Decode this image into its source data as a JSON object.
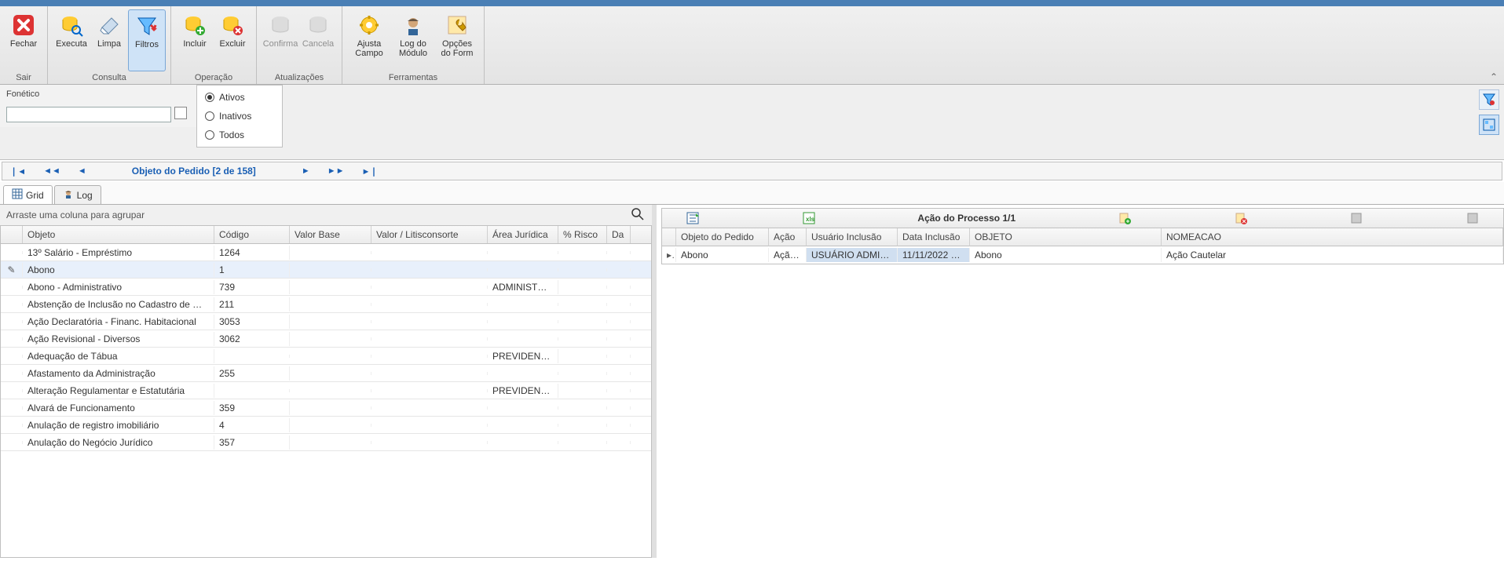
{
  "ribbon": {
    "groups": {
      "sair": "Sair",
      "consulta": "Consulta",
      "operacao": "Operação",
      "atualizacoes": "Atualizações",
      "ferramentas": "Ferramentas"
    },
    "fechar": "Fechar",
    "executa": "Executa",
    "limpa": "Limpa",
    "filtros": "Filtros",
    "incluir": "Incluir",
    "excluir": "Excluir",
    "confirma": "Confirma",
    "cancela": "Cancela",
    "ajusta_campo": "Ajusta Campo",
    "log_modulo": "Log do Módulo",
    "opcoes_form": "Opções do Form"
  },
  "filter": {
    "fonetico_label": "Fonético",
    "radio_ativos": "Ativos",
    "radio_inativos": "Inativos",
    "radio_todos": "Todos"
  },
  "navigator": {
    "title": "Objeto do Pedido [2 de 158]"
  },
  "tabs": {
    "grid": "Grid",
    "log": "Log"
  },
  "left_grid": {
    "group_hint": "Arraste uma coluna para agrupar",
    "cols": {
      "objeto": "Objeto",
      "codigo": "Código",
      "valor_base": "Valor Base",
      "valor_litis": "Valor / Litisconsorte",
      "area_juridica": "Área Jurídica",
      "risco": "% Risco",
      "da": "Da"
    },
    "rows": [
      {
        "objeto": "13º Salário - Empréstimo",
        "codigo": "1264",
        "area": ""
      },
      {
        "objeto": "Abono",
        "codigo": "1",
        "area": "",
        "selected": true
      },
      {
        "objeto": "Abono - Administrativo",
        "codigo": "739",
        "area": "ADMINISTRATI..."
      },
      {
        "objeto": "Abstenção de Inclusão no Cadastro de Órgão...",
        "codigo": "211",
        "area": ""
      },
      {
        "objeto": "Ação Declaratória - Financ. Habitacional",
        "codigo": "3053",
        "area": ""
      },
      {
        "objeto": "Ação Revisional - Diversos",
        "codigo": "3062",
        "area": ""
      },
      {
        "objeto": "Adequação de Tábua",
        "codigo": "",
        "area": "PREVIDENCIAR..."
      },
      {
        "objeto": "Afastamento da Administração",
        "codigo": "255",
        "area": ""
      },
      {
        "objeto": "Alteração Regulamentar e Estatutária",
        "codigo": "",
        "area": "PREVIDENCIAR..."
      },
      {
        "objeto": "Alvará de Funcionamento",
        "codigo": "359",
        "area": ""
      },
      {
        "objeto": "Anulação de registro imobiliário",
        "codigo": "4",
        "area": ""
      },
      {
        "objeto": "Anulação do Negócio Jurídico",
        "codigo": "357",
        "area": ""
      }
    ]
  },
  "right_grid": {
    "title": "Ação do Processo 1/1",
    "cols": {
      "objeto_pedido": "Objeto do Pedido",
      "acao": "Ação",
      "usuario_inclusao": "Usuário Inclusão",
      "data_inclusao": "Data Inclusão",
      "objeto": "OBJETO",
      "nomeacao": "NOMEACAO"
    },
    "row": {
      "objeto_pedido": "Abono",
      "acao": "Ação...",
      "usuario": "USUÁRIO ADMINIS...",
      "data": "11/11/2022 11...",
      "objeto": "Abono",
      "nomeacao": "Ação Cautelar"
    }
  }
}
